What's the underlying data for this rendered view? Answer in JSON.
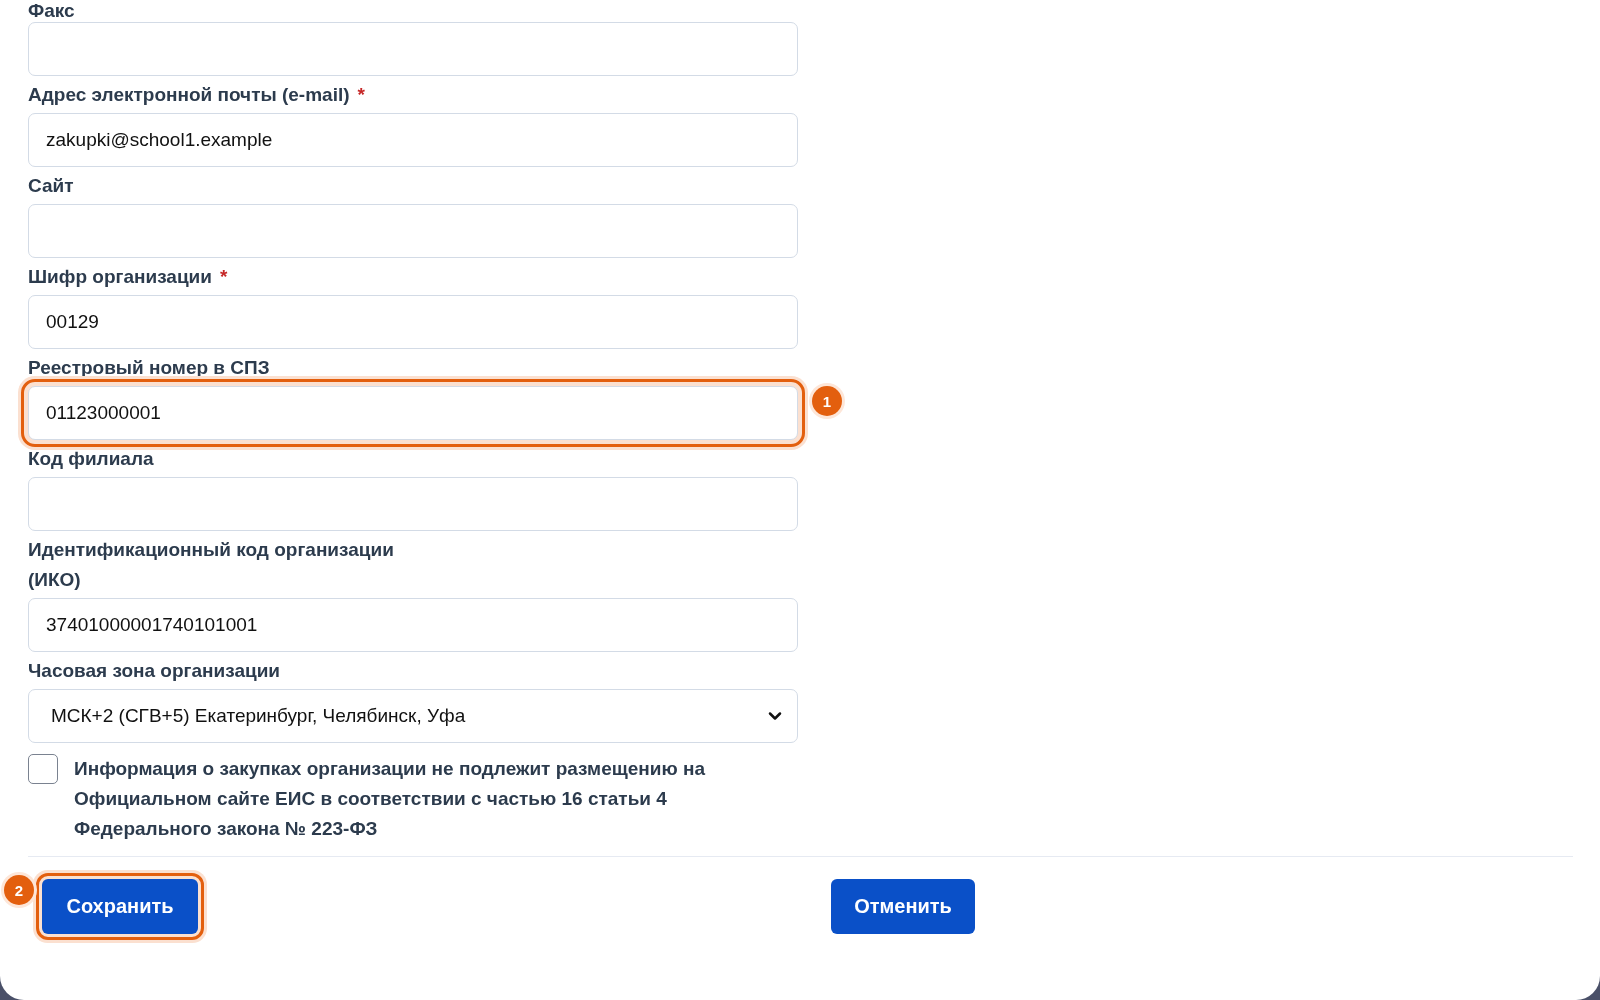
{
  "fields": [
    {
      "label": "Факс",
      "kind": "text"
    },
    {
      "label": "Адрес электронной почты (e-mail)",
      "required_mark": "*",
      "kind": "text",
      "value": "zakupki@school1.example"
    },
    {
      "label": "Сайт",
      "kind": "text"
    },
    {
      "label": "Шифр организации",
      "required_mark": "*",
      "kind": "text",
      "value": "00129"
    },
    {
      "label": "Реестровый номер в СПЗ",
      "kind": "text",
      "value": "01123000001",
      "highlighted": true,
      "badge": "1"
    },
    {
      "label": "Код филиала",
      "kind": "text"
    },
    {
      "label": "Идентификационный код организации (ИКО)",
      "kind": "text",
      "value": "37401000001740101001"
    },
    {
      "label": "Часовая зона организации",
      "kind": "select",
      "value": "МСК+2 (СГВ+5) Екатеринбург, Челябинск, Уфа"
    }
  ],
  "checkbox": {
    "label": "Информация о закупках организации не подлежит размещению на Официальном сайте ЕИС в соответствии с частью 16 статьи 4 Федерального закона № 223-ФЗ",
    "checked": false
  },
  "buttons": [
    {
      "label": "Сохранить",
      "highlighted": true,
      "badge": "2"
    },
    {
      "label": "Отменить",
      "highlighted": false
    }
  ]
}
